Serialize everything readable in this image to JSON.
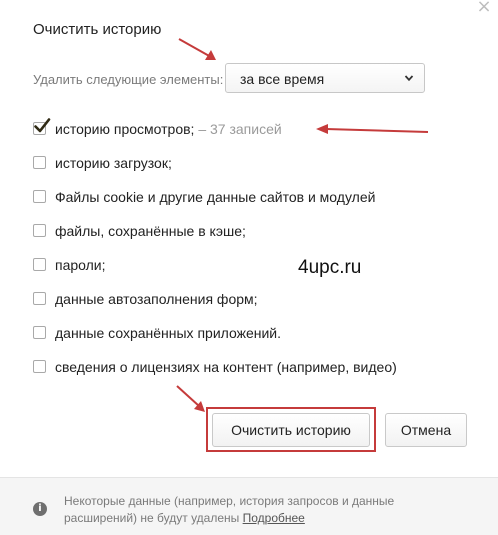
{
  "dialog": {
    "title": "Очистить историю",
    "close_glyph": "×",
    "period": {
      "label": "Удалить следующие элементы:",
      "selected": "за все время"
    },
    "items": [
      {
        "label": "историю просмотров;",
        "extra": "– 37 записей",
        "checked": true
      },
      {
        "label": "историю загрузок;",
        "checked": false
      },
      {
        "label": "Файлы cookie и другие данные сайтов и модулей",
        "checked": false
      },
      {
        "label": "файлы, сохранённые в кэше;",
        "checked": false
      },
      {
        "label": "пароли;",
        "checked": false
      },
      {
        "label": "данные автозаполнения форм;",
        "checked": false
      },
      {
        "label": "данные сохранённых приложений.",
        "checked": false
      },
      {
        "label": "сведения о лицензиях на контент (например, видео)",
        "checked": false
      }
    ],
    "buttons": {
      "clear": "Очистить историю",
      "cancel": "Отмена"
    },
    "footer": {
      "text": "Некоторые данные (например, история запросов и данные расширений) не будут удалены",
      "link": "Подробнее"
    }
  },
  "watermark": "4upc.ru",
  "icons": {
    "info": "info-icon",
    "dropdown": "chevron-down-icon",
    "check": "checkmark-icon"
  },
  "colors": {
    "annotation": "#c53b3b",
    "checkmark": "#2f2a14"
  }
}
